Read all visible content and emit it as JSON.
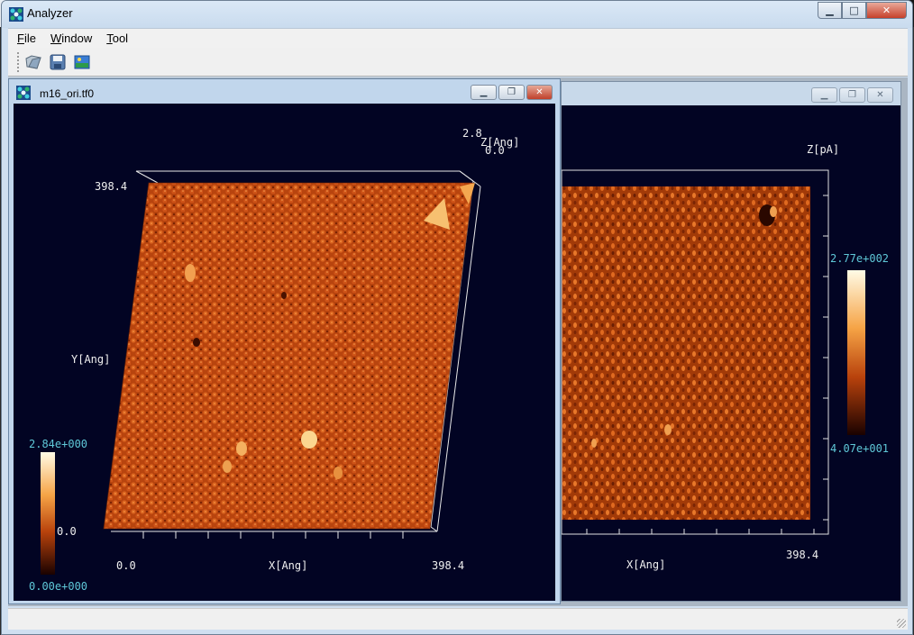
{
  "app": {
    "title": "Analyzer"
  },
  "menu": [
    "File",
    "Window",
    "Tool"
  ],
  "toolbar": {
    "icons": [
      "open-icon",
      "save-icon",
      "image-icon"
    ]
  },
  "window_left": {
    "title": "m16_ori.tf0",
    "z_max": "2.8",
    "z_axis_label": "Z[Ang]",
    "z_min": "0.0",
    "y_max": "398.4",
    "y_axis_label": "Y[Ang]",
    "x_min": "0.0",
    "x_axis_label": "X[Ang]",
    "x_max": "398.4",
    "cbar_max": "2.84e+000",
    "cbar_mid": "0.0",
    "cbar_min": "0.00e+000"
  },
  "window_right": {
    "z_axis_label": "Z[pA]",
    "cbar_max": "2.77e+002",
    "cbar_min": "4.07e+001",
    "x_axis_label": "X[Ang]",
    "x_max": "398.4"
  },
  "colors": {
    "plot_bg": "#020423",
    "surface_base": "#c84a10",
    "surface_dark": "#8a2a05",
    "surface_light": "#e87a2c",
    "tick_cyan": "#5fc8d8"
  }
}
